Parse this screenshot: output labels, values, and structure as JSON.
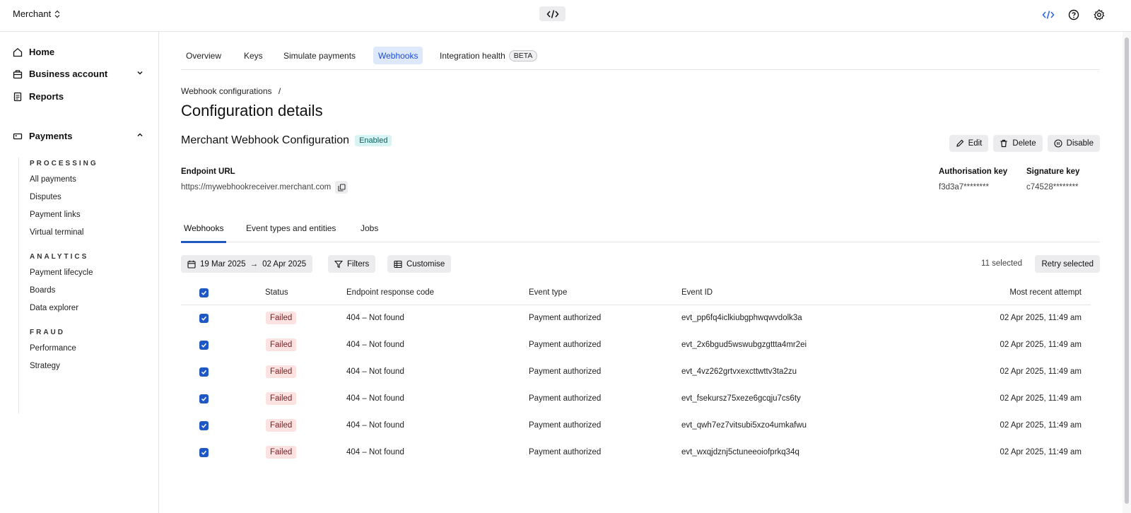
{
  "topbar": {
    "merchant_label": "Merchant"
  },
  "sidebar": {
    "main_items": [
      {
        "label": "Home"
      },
      {
        "label": "Business account"
      },
      {
        "label": "Reports"
      }
    ],
    "payments_label": "Payments",
    "sections": [
      {
        "label": "PROCESSING",
        "items": [
          "All payments",
          "Disputes",
          "Payment links",
          "Virtual terminal"
        ]
      },
      {
        "label": "ANALYTICS",
        "items": [
          "Payment lifecycle",
          "Boards",
          "Data explorer"
        ]
      },
      {
        "label": "FRAUD",
        "items": [
          "Performance",
          "Strategy"
        ]
      }
    ]
  },
  "tabs": [
    {
      "label": "Overview"
    },
    {
      "label": "Keys"
    },
    {
      "label": "Simulate payments"
    },
    {
      "label": "Webhooks"
    },
    {
      "label": "Integration health",
      "badge": "BETA"
    }
  ],
  "breadcrumb": {
    "parent": "Webhook configurations",
    "separator": "/"
  },
  "page_title": "Configuration details",
  "config": {
    "name": "Merchant Webhook Configuration",
    "status": "Enabled",
    "actions": {
      "edit": "Edit",
      "delete": "Delete",
      "disable": "Disable"
    },
    "endpoint_label": "Endpoint URL",
    "endpoint_value": "https://mywebhookreceiver.merchant.com",
    "auth_key_label": "Authorisation key",
    "auth_key_value": "f3d3a7********",
    "sig_key_label": "Signature key",
    "sig_key_value": "c74528********"
  },
  "subtabs": [
    {
      "label": "Webhooks"
    },
    {
      "label": "Event types and entities"
    },
    {
      "label": "Jobs"
    }
  ],
  "toolbar": {
    "date_from": "19 Mar 2025",
    "date_arrow": "→",
    "date_to": "02 Apr 2025",
    "filters": "Filters",
    "customise": "Customise",
    "selected_count": "11 selected",
    "retry": "Retry selected"
  },
  "table": {
    "headers": {
      "status": "Status",
      "code": "Endpoint response code",
      "event_type": "Event type",
      "event_id": "Event ID",
      "attempt": "Most recent attempt"
    },
    "rows": [
      {
        "status": "Failed",
        "code": "404 – Not found",
        "event_type": "Payment authorized",
        "event_id": "evt_pp6fq4iclkiubgphwqwvdolk3a",
        "attempt": "02 Apr 2025, 11:49 am"
      },
      {
        "status": "Failed",
        "code": "404 – Not found",
        "event_type": "Payment authorized",
        "event_id": "evt_2x6bgud5wswubgzgttta4mr2ei",
        "attempt": "02 Apr 2025, 11:49 am"
      },
      {
        "status": "Failed",
        "code": "404 – Not found",
        "event_type": "Payment authorized",
        "event_id": "evt_4vz262grtvxexcttwttv3ta2zu",
        "attempt": "02 Apr 2025, 11:49 am"
      },
      {
        "status": "Failed",
        "code": "404 – Not found",
        "event_type": "Payment authorized",
        "event_id": "evt_fsekursz75xeze6gcqju7cs6ty",
        "attempt": "02 Apr 2025, 11:49 am"
      },
      {
        "status": "Failed",
        "code": "404 – Not found",
        "event_type": "Payment authorized",
        "event_id": "evt_qwh7ez7vitsubi5xzo4umkafwu",
        "attempt": "02 Apr 2025, 11:49 am"
      },
      {
        "status": "Failed",
        "code": "404 – Not found",
        "event_type": "Payment authorized",
        "event_id": "evt_wxqjdznj5ctuneeoiofprkq34q",
        "attempt": "02 Apr 2025, 11:49 am"
      }
    ]
  },
  "colors": {
    "accent": "#1f57c3",
    "failed_bg": "#fde2e2",
    "enabled_bg": "#d6f4f4"
  }
}
